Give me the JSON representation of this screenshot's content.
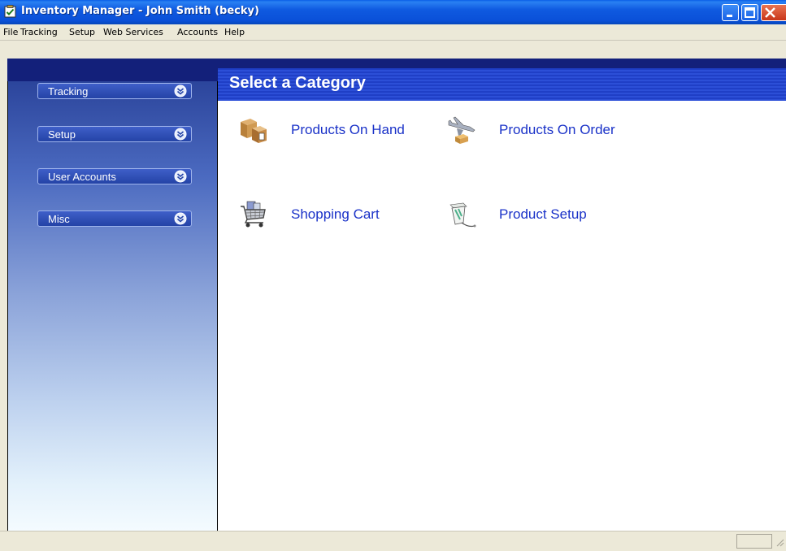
{
  "window": {
    "title": "Inventory Manager - John Smith (becky)",
    "app_icon": "clipboard-check-icon",
    "controls": [
      "minimize-icon",
      "maximize-icon",
      "close-icon"
    ]
  },
  "menu": {
    "items": [
      "File",
      "Tracking",
      "Setup",
      "Web Services",
      "Accounts",
      "Help"
    ]
  },
  "sidebar": {
    "items": [
      {
        "label": "Tracking",
        "icon": "chevron-down-circle-icon"
      },
      {
        "label": "Setup",
        "icon": "chevron-down-circle-icon"
      },
      {
        "label": "User Accounts",
        "icon": "chevron-down-circle-icon"
      },
      {
        "label": "Misc",
        "icon": "chevron-down-circle-icon"
      }
    ]
  },
  "main": {
    "header": "Select a Category",
    "categories": [
      {
        "label": "Products On Hand",
        "icon": "boxes-icon"
      },
      {
        "label": "Products On Order",
        "icon": "airplane-package-icon"
      },
      {
        "label": "Shopping Cart",
        "icon": "shopping-cart-icon"
      },
      {
        "label": "Product Setup",
        "icon": "product-box-icon"
      }
    ]
  },
  "colors": {
    "titlebar": "#0a50d8",
    "header_bar": "#1f3fc6",
    "link": "#1a32c8",
    "sidebar_top": "#13207a"
  }
}
